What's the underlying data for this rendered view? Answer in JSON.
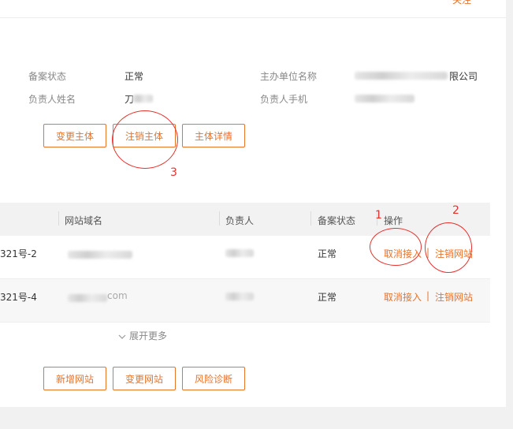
{
  "header": {
    "top_link": "关注"
  },
  "info": {
    "status_label": "备案状态",
    "status_value": "正常",
    "owner_label": "负责人姓名",
    "owner_value_visible": "刀",
    "org_label": "主办单位名称",
    "org_value_visible": "限公司",
    "phone_label": "负责人手机"
  },
  "subject_buttons": {
    "change": "变更主体",
    "cancel": "注销主体",
    "detail": "主体详情"
  },
  "table": {
    "headers": {
      "domain": "网站域名",
      "owner": "负责人",
      "status": "备案状态",
      "ops": "操作"
    },
    "rows": [
      {
        "id_suffix": "321号-2",
        "domain_visible": "",
        "owner_visible": "",
        "status": "正常",
        "op_cancel_access": "取消接入",
        "op_sep": "|",
        "op_cancel_site": "注销网站"
      },
      {
        "id_suffix": "321号-4",
        "domain_visible": "com",
        "owner_visible": "",
        "status": "正常",
        "op_cancel_access": "取消接入",
        "op_sep": "|",
        "op_cancel_site": "注销网站"
      }
    ],
    "expand_icon": "chevron-down-icon",
    "expand_label": "展开更多"
  },
  "site_buttons": {
    "add": "新增网站",
    "change": "变更网站",
    "risk": "风险诊断"
  },
  "annotations": {
    "one": "1",
    "two": "2",
    "three": "3"
  },
  "colors": {
    "accent": "#e8732a",
    "annotation": "#e5322e"
  }
}
